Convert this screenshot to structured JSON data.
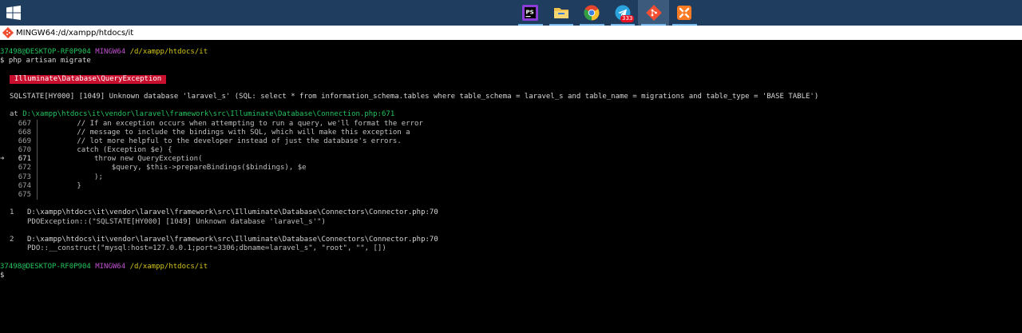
{
  "taskbar": {
    "icons": [
      {
        "name": "phpstorm-icon",
        "label": "PS",
        "color": "#8b3bd6"
      },
      {
        "name": "file-explorer-icon",
        "color": "#f2c14e"
      },
      {
        "name": "chrome-icon",
        "color": "#e6452d"
      },
      {
        "name": "telegram-icon",
        "color": "#2aa3df",
        "badge": "333"
      },
      {
        "name": "git-icon",
        "color": "#f14e32"
      },
      {
        "name": "xampp-icon",
        "color": "#fb7a24"
      }
    ]
  },
  "window": {
    "title": "MINGW64:/d/xampp/htdocs/it"
  },
  "terminal": {
    "prompt1": {
      "user": "37498@DESKTOP-RF0P904",
      "shell": "MINGW64",
      "path": "/d/xampp/htdocs/it"
    },
    "command": "$ php artisan migrate",
    "exception_class": "Illuminate\\Database\\QueryException",
    "error_message": "SQLSTATE[HY000] [1049] Unknown database 'laravel_s' (SQL: select * from information_schema.tables where table_schema = laravel_s and table_name = migrations and table_type = 'BASE TABLE')",
    "at_prefix": "at ",
    "at_file": "D:\\xampp\\htdocs\\it\\vendor\\laravel\\framework\\src\\Illuminate\\Database\\Connection.php",
    "at_line": ":671",
    "code_lines": [
      {
        "n": "667",
        "code": "        // If an exception occurs when attempting to run a query, we'll format the error",
        "current": false
      },
      {
        "n": "668",
        "code": "        // message to include the bindings with SQL, which will make this exception a",
        "current": false
      },
      {
        "n": "669",
        "code": "        // lot more helpful to the developer instead of just the database's errors.",
        "current": false
      },
      {
        "n": "670",
        "code": "        catch (Exception $e) {",
        "current": false
      },
      {
        "n": "671",
        "code": "            throw new QueryException(",
        "current": true
      },
      {
        "n": "672",
        "code": "                $query, $this->prepareBindings($bindings), $e",
        "current": false
      },
      {
        "n": "673",
        "code": "            );",
        "current": false
      },
      {
        "n": "674",
        "code": "        }",
        "current": false
      },
      {
        "n": "675",
        "code": "",
        "current": false
      }
    ],
    "current_arrow": "➜",
    "trace": [
      {
        "num": "1",
        "file": "D:\\xampp\\htdocs\\it\\vendor\\laravel\\framework\\src\\Illuminate\\Database\\Connectors\\Connector.php:70",
        "call": "PDOException::(\"SQLSTATE[HY000] [1049] Unknown database 'laravel_s'\")"
      },
      {
        "num": "2",
        "file": "D:\\xampp\\htdocs\\it\\vendor\\laravel\\framework\\src\\Illuminate\\Database\\Connectors\\Connector.php:70",
        "call": "PDO::__construct(\"mysql:host=127.0.0.1;port=3306;dbname=laravel_s\", \"root\", \"\", [])"
      }
    ],
    "prompt2": {
      "user": "37498@DESKTOP-RF0P904",
      "shell": "MINGW64",
      "path": "/d/xampp/htdocs/it"
    },
    "final_prompt": "$"
  }
}
